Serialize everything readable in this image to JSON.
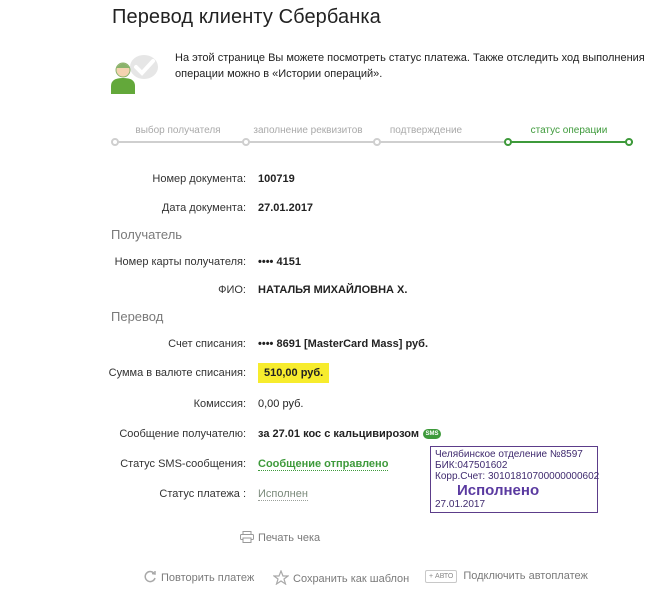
{
  "page": {
    "title": "Перевод клиенту Сбербанка",
    "info_text": "На этой странице Вы можете посмотреть статус платежа. Также отследить ход выполнения операции можно в «Истории операций»."
  },
  "steps": [
    {
      "label": "выбор получателя",
      "active": false
    },
    {
      "label": "заполнение реквизитов",
      "active": false
    },
    {
      "label": "подтверждение",
      "active": false
    },
    {
      "label": "статус операции",
      "active": true
    }
  ],
  "document": {
    "number_label": "Номер документа:",
    "number_value": "100719",
    "date_label": "Дата документа:",
    "date_value": "27.01.2017"
  },
  "recipient": {
    "section": "Получатель",
    "card_label": "Номер карты получателя:",
    "card_value": "•••• 4151",
    "name_label": "ФИО:",
    "name_value": "НАТАЛЬЯ МИХАЙЛОВНА Х."
  },
  "transfer": {
    "section": "Перевод",
    "account_label": "Счет списания:",
    "account_value": "•••• 8691  [MasterCard Mass]  руб.",
    "amount_label": "Сумма в валюте списания:",
    "amount_value": "510,00  руб.",
    "fee_label": "Комиссия:",
    "fee_value": "0,00 руб.",
    "message_label": "Сообщение получателю:",
    "message_value": "за 27.01 кос с кальцивирозом",
    "sms_badge": "SMS",
    "sms_status_label": "Статус SMS-сообщения:",
    "sms_status_value": "Сообщение отправлено",
    "payment_status_label": "Статус платежа :",
    "payment_status_value": "Исполнен"
  },
  "stamp": {
    "line1": "Челябинское отделение №8597",
    "line2": "БИК:047501602",
    "line3": "Корр.Счет: 30101810700000000602",
    "status": "Исполнено",
    "date": "27.01.2017"
  },
  "actions": {
    "print": "Печать чека",
    "repeat": "Повторить платеж",
    "save_template": "Сохранить как шаблон",
    "auto_badge": "АВТО",
    "autopay": "Подключить автоплатеж"
  },
  "colors": {
    "accent_green": "#3e9a3b",
    "highlight_yellow": "#f7ec2d",
    "stamp_purple": "#5c3d8a"
  }
}
